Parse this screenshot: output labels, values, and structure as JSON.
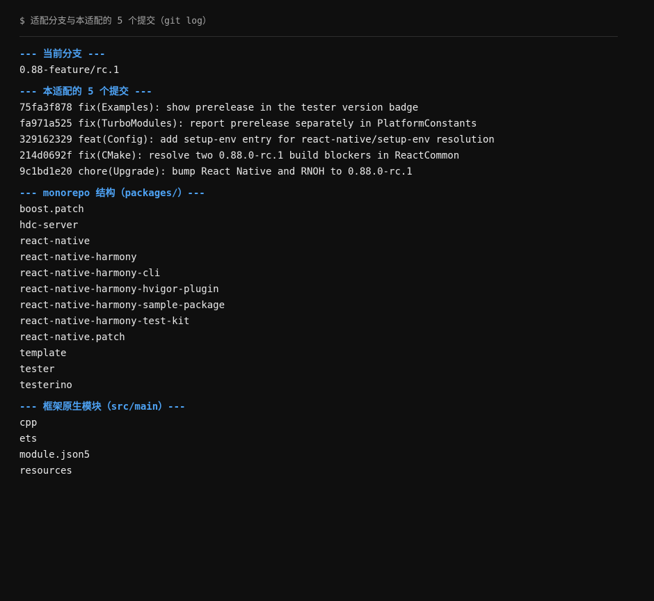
{
  "command": "$ 适配分支与本适配的 5 个提交（git log）",
  "sections": [
    {
      "title": "--- 当前分支 ---",
      "lines": [
        "0.88-feature/rc.1"
      ]
    },
    {
      "title": "--- 本适配的 5 个提交 ---",
      "lines": [
        "75fa3f878 fix(Examples): show prerelease in the tester version badge",
        "fa971a525 fix(TurboModules): report prerelease separately in PlatformConstants",
        "329162329 feat(Config): add setup-env entry for react-native/setup-env resolution",
        "214d0692f fix(CMake): resolve two 0.88.0-rc.1 build blockers in ReactCommon",
        "9c1bd1e20 chore(Upgrade): bump React Native and RNOH to 0.88.0-rc.1"
      ]
    },
    {
      "title": "--- monorepo 结构（packages/）---",
      "lines": [
        "boost.patch",
        "hdc-server",
        "react-native",
        "react-native-harmony",
        "react-native-harmony-cli",
        "react-native-harmony-hvigor-plugin",
        "react-native-harmony-sample-package",
        "react-native-harmony-test-kit",
        "react-native.patch",
        "template",
        "tester",
        "testerino"
      ]
    },
    {
      "title": "--- 框架原生模块（src/main）---",
      "lines": [
        "cpp",
        "ets",
        "module.json5",
        "resources"
      ]
    }
  ]
}
